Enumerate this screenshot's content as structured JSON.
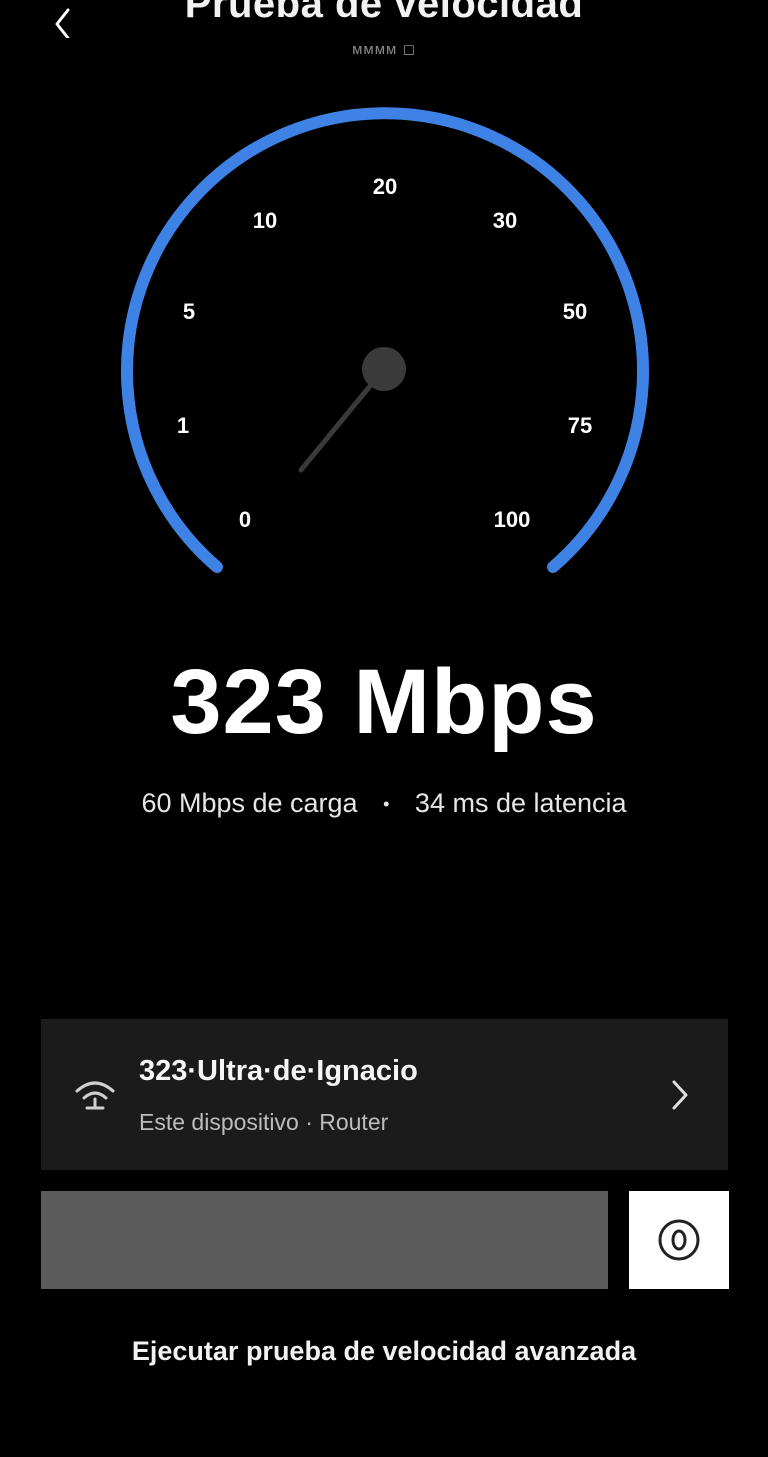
{
  "header": {
    "title": "Prueba de velocidad",
    "subtitle": "ᴍᴍᴍᴍ ◻"
  },
  "gauge": {
    "arc_color": "#3f82e6",
    "tick_labels": [
      "0",
      "1",
      "5",
      "10",
      "20",
      "30",
      "50",
      "75",
      "100"
    ]
  },
  "result": {
    "speed": "323 Mbps",
    "upload": "60 Mbps de carga",
    "latency": "34 ms de latencia"
  },
  "network": {
    "name": "323·Ultra·de·Ignacio",
    "details": "Este dispositivo · Router"
  },
  "advanced_link": "Ejecutar prueba de velocidad avanzada",
  "icons": {
    "back": "chevron-left-icon",
    "wifi": "wifi-icon",
    "chevron": "chevron-right-icon",
    "power": "power-icon"
  }
}
